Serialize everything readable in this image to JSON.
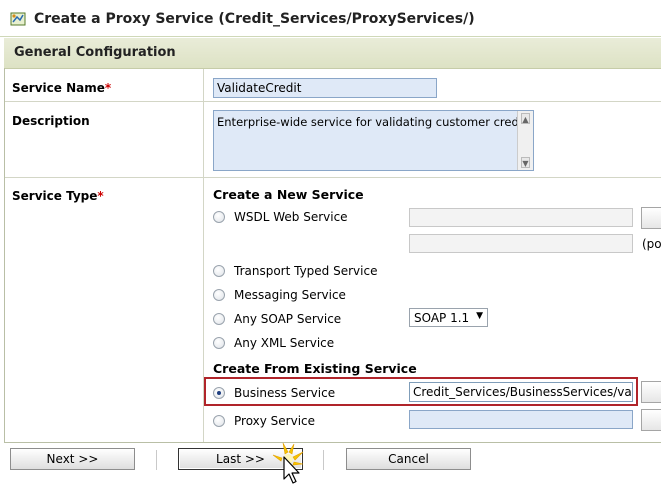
{
  "window": {
    "title": "Create a Proxy Service (Credit_Services/ProxyServices/)",
    "icon": "proxy-service-icon"
  },
  "section": {
    "title": "General Configuration"
  },
  "form": {
    "service_name": {
      "label": "Service Name",
      "required_mark": "*",
      "value": "ValidateCredit"
    },
    "description": {
      "label": "Description",
      "value": "Enterprise-wide service for validating customer credit."
    },
    "service_type": {
      "label": "Service Type",
      "required_mark": "*",
      "create_new_heading": "Create a New Service",
      "options": {
        "wsdl": "WSDL Web Service",
        "transport": "Transport Typed Service",
        "messaging": "Messaging Service",
        "any_soap": "Any SOAP Service",
        "any_xml": "Any XML Service"
      },
      "wsdl_hint": "(po",
      "soap_version": "SOAP 1.1",
      "existing_heading": "Create From Existing Service",
      "business_service": {
        "label": "Business Service",
        "value": "Credit_Services/BusinessServices/validatio",
        "selected": true
      },
      "proxy_service": {
        "label": "Proxy Service",
        "value": ""
      }
    }
  },
  "footer": {
    "next": "Next >>",
    "last": "Last >>",
    "cancel": "Cancel"
  },
  "colors": {
    "required": "#cc0000",
    "highlight": "#b0242a",
    "input_bg": "#dfe9f7"
  }
}
